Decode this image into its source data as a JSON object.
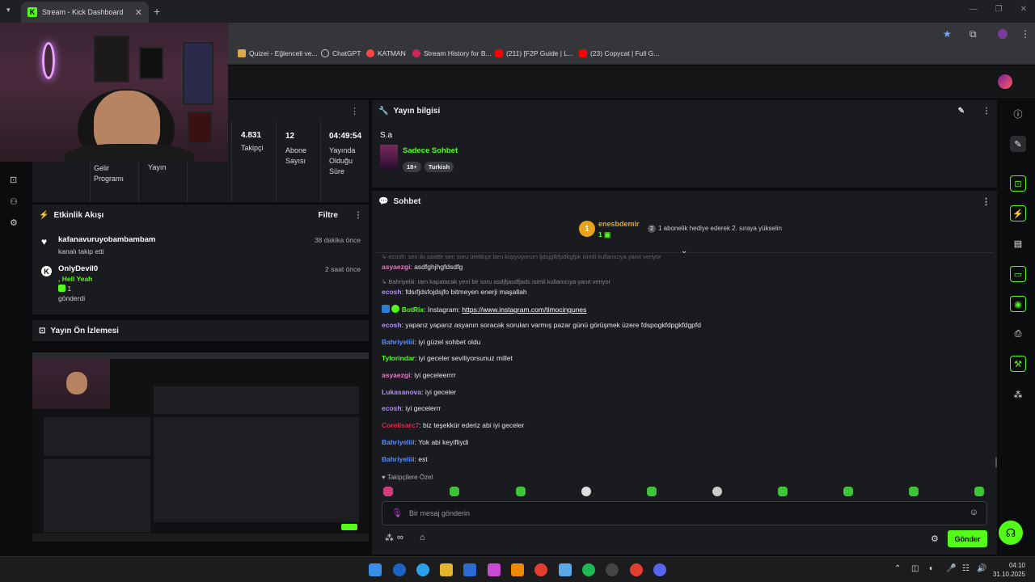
{
  "browser": {
    "tab_title": "Stream - Kick Dashboard",
    "tab_close": "✕",
    "new_tab": "+",
    "bookmarks": [
      {
        "label": "Quizei - Eğlenceli ve...",
        "color": "#d9a94a"
      },
      {
        "label": "ChatGPT",
        "color": "#cccccc"
      },
      {
        "label": "KATMAN",
        "color": "#ff4444"
      },
      {
        "label": "Stream History for B...",
        "color": "#d0245a"
      },
      {
        "label": "(211) [F2P Guide | L...",
        "color": "#ff0000"
      },
      {
        "label": "(23) Copycat | Full G...",
        "color": "#ff0000"
      }
    ]
  },
  "stats": {
    "items": [
      {
        "label_1": "Gelir",
        "label_2": "Programı"
      },
      {
        "label_1": "Yayın",
        "label_2": ""
      },
      {
        "value": "4.831",
        "label": "Takipçi"
      },
      {
        "value": "12",
        "label_1": "Abone",
        "label_2": "Sayısı"
      },
      {
        "value": "04:49:54",
        "label_1": "Yayında",
        "label_2": "Olduğu",
        "label_3": "Süre"
      }
    ]
  },
  "activity": {
    "title": "Etkinlik Akışı",
    "filter": "Filtre",
    "events": [
      {
        "name": "kafanavuruyobambambam",
        "sub": "kanalı takip etti",
        "time": "38 dakika önce"
      },
      {
        "name": "OnlyDevil0",
        "line2": ", Hell Yeah",
        "line3": "1",
        "sub": "gönderdi",
        "time": "2 saat önce"
      }
    ]
  },
  "preview": {
    "title": "Yayın Ön İzlemesi"
  },
  "stream_info": {
    "title": "Yayın bilgisi",
    "stream_title": "S.a",
    "category": "Sadece Sohbet",
    "tags": [
      "18+",
      "Turkish"
    ]
  },
  "chat": {
    "title": "Sohbet",
    "top_gifter": {
      "rank": "1",
      "name": "enesbdemir",
      "count": "1"
    },
    "gift_prompt": "1 abonelik hediye ederek 2. sıraya yükselin",
    "replies": [
      "ecosh: sen iki saattir sen soru üretikçe ben kopyoyorum ljdsjgfkfpdkgfpk isimli kullanıcıya yanıt veriyor",
      "Bahriyeliii: tam kapatacak yeni bir soru asdjfjasdfjads isimli kullanıcıya yanıt veriyor"
    ],
    "messages": [
      {
        "user": "asyaezgi",
        "text": "asdfghjhgfdsdfg",
        "color": "#e879c6"
      },
      {
        "user": "ecosh",
        "text": "fdsıfjdsfojdsjfo bitmeyen enerji maşallah",
        "color": "#b78cff"
      },
      {
        "user": "BotRix",
        "text": "İnstagram: ",
        "link": "https://www.instagram.com/timocingunes",
        "color": "#53fc18"
      },
      {
        "user": "ecosh",
        "text": "yaparız yaparız asyanın soracak soruları varmış pazar günü görüşmek üzere fdspogkfdpgkfdgpfd",
        "color": "#b78cff"
      },
      {
        "user": "Bahriyeliii",
        "text": "iyi güzel sohbet oldu",
        "color": "#5a8cff"
      },
      {
        "user": "Tylorindar",
        "text": "iyi geceler seviliyorsunuz millet",
        "color": "#53fc18"
      },
      {
        "user": "asyaezgi",
        "text": "iyi geceleerrrr",
        "color": "#e879c6"
      },
      {
        "user": "Lukasanova",
        "text": "iyi geceler",
        "color": "#b78cff"
      },
      {
        "user": "ecosh",
        "text": "iyi gecelerrr",
        "color": "#b78cff"
      },
      {
        "user": "Corelisarc7",
        "text": "biz teşekkür ederiz abi iyi geceler",
        "color": "#e0284a"
      },
      {
        "user": "Bahriyeliii",
        "text": "Yok abi keyifliydi",
        "color": "#5a8cff"
      },
      {
        "user": "Bahriyeliii",
        "text": "est",
        "color": "#5a8cff"
      }
    ],
    "followers_only": "Takipçilere Özel",
    "input_placeholder": "Bir mesaj gönderin",
    "send_label": "Gönder"
  },
  "taskbar": {
    "time": "04:10",
    "date": "31.10.2025"
  },
  "colors": {
    "accent": "#53fc18",
    "panel": "#191b1f",
    "background": "#0b0c0d"
  }
}
